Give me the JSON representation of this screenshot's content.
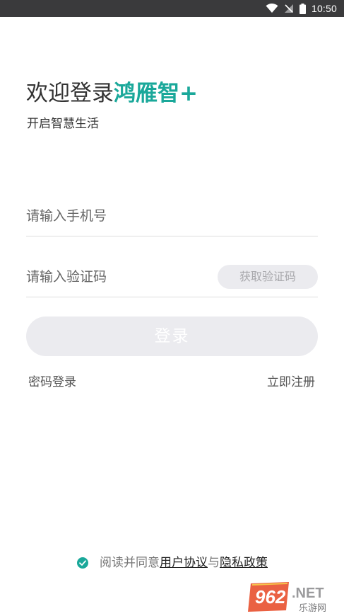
{
  "status_bar": {
    "time": "10:50"
  },
  "header": {
    "title_prefix": "欢迎登录",
    "title_brand": "鸿雁智+",
    "subtitle": "开启智慧生活"
  },
  "form": {
    "phone_placeholder": "请输入手机号",
    "code_placeholder": "请输入验证码",
    "get_code_label": "获取验证码",
    "login_label": "登录"
  },
  "links": {
    "password_login": "密码登录",
    "register": "立即注册"
  },
  "agreement": {
    "prefix": "阅读并同意",
    "user_agreement": "用户协议",
    "conjunction": "与",
    "privacy_policy": "隐私政策",
    "checked": true
  },
  "watermark": {
    "brand_number": "962",
    "brand_suffix": ".NET",
    "brand_cn": "乐游网"
  },
  "colors": {
    "accent": "#1aa89a",
    "status_bar": "#3a3a3c",
    "button_disabled_bg": "#ebebef"
  }
}
